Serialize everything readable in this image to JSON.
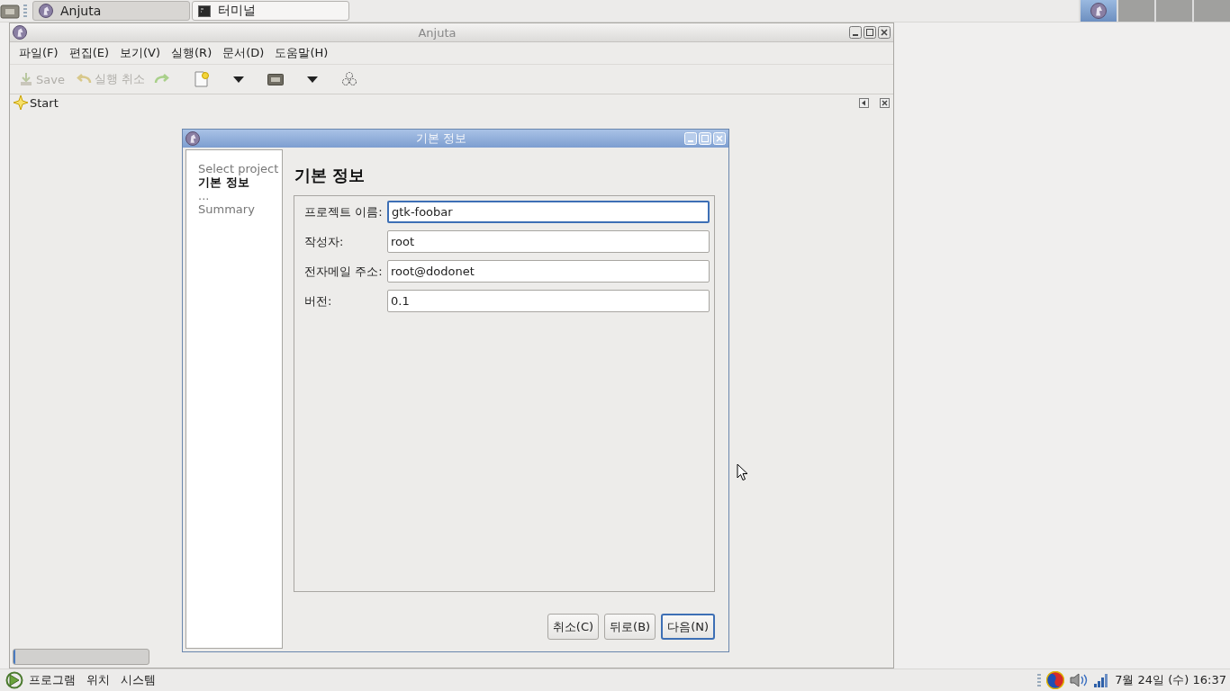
{
  "top_panel": {
    "tasks": [
      {
        "label": "Anjuta",
        "selected": true
      },
      {
        "label": "터미널",
        "selected": false
      }
    ],
    "workspaces": [
      {
        "selected": true
      },
      {
        "selected": false
      },
      {
        "selected": false
      },
      {
        "selected": false
      }
    ]
  },
  "window": {
    "title": "Anjuta",
    "menu": [
      "파일(F)",
      "편집(E)",
      "보기(V)",
      "실행(R)",
      "문서(D)",
      "도움말(H)"
    ],
    "toolbar": [
      {
        "label": "Save",
        "disabled": true
      },
      {
        "label": "실행 취소",
        "disabled": true
      }
    ],
    "doc_tab": "Start",
    "progress": {
      "level": 0
    }
  },
  "dialog": {
    "title": "기본 정보",
    "steps": [
      {
        "label": "Select project",
        "current": false
      },
      {
        "label": "기본 정보",
        "current": true
      },
      {
        "label": "...",
        "current": false
      },
      {
        "label": "Summary",
        "current": false
      }
    ],
    "heading": "기본 정보",
    "fields": [
      {
        "label": "프로젝트 이름:",
        "value": "gtk-foobar",
        "focused": true
      },
      {
        "label": "작성자:",
        "value": "root",
        "focused": false
      },
      {
        "label": "전자메일 주소:",
        "value": "root@dodonet",
        "focused": false
      },
      {
        "label": "버전:",
        "value": "0.1",
        "focused": false
      }
    ],
    "buttons": [
      {
        "label": "취소(C)",
        "default": false
      },
      {
        "label": "뒤로(B)",
        "default": false
      },
      {
        "label": "다음(N)",
        "default": true
      }
    ]
  },
  "bottom_panel": {
    "menus": [
      "프로그램",
      "위치",
      "시스템"
    ],
    "clock": "7월 24일 (수) 16:37"
  }
}
